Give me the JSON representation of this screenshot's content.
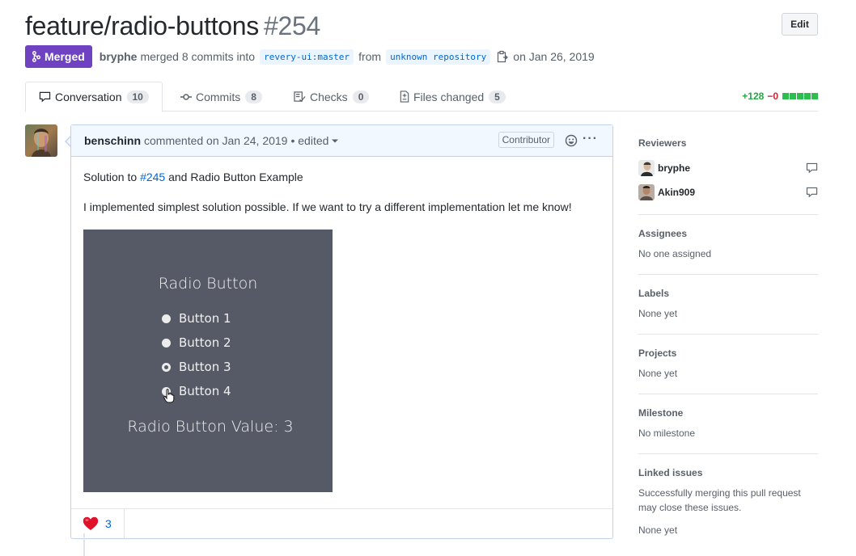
{
  "pr": {
    "title": "feature/radio-buttons",
    "number": "#254",
    "edit_label": "Edit",
    "state_label": "Merged",
    "author": "bryphe",
    "merge_text": "merged 8 commits into",
    "base_branch": "revery-ui:master",
    "from_text": "from",
    "head_branch": "unknown repository",
    "date_text": "on Jan 26, 2019"
  },
  "tabs": [
    {
      "label": "Conversation",
      "count": "10",
      "icon": "comment-icon"
    },
    {
      "label": "Commits",
      "count": "8",
      "icon": "commit-icon"
    },
    {
      "label": "Checks",
      "count": "0",
      "icon": "checklist-icon"
    },
    {
      "label": "Files changed",
      "count": "5",
      "icon": "file-diff-icon"
    }
  ],
  "diffstat": {
    "additions": "+128",
    "deletions": "−0"
  },
  "comment": {
    "author": "benschinn",
    "action": "commented on Jan 24, 2019",
    "edited": "• edited",
    "role_label": "Contributor",
    "line1_prefix": "Solution to ",
    "line1_link": "#245",
    "line1_suffix": " and Radio Button Example",
    "line2": "I implemented simplest solution possible. If we want to try a different implementation let me know!",
    "image": {
      "title": "Radio Button",
      "options": [
        "Button 1",
        "Button 2",
        "Button 3",
        "Button 4"
      ],
      "selected_index": 2,
      "value_text": "Radio Button Value: 3"
    },
    "reactions": [
      {
        "emoji": "heart-icon",
        "count": "3"
      }
    ]
  },
  "sidebar": {
    "reviewers_heading": "Reviewers",
    "reviewers": [
      {
        "name": "bryphe"
      },
      {
        "name": "Akin909"
      }
    ],
    "assignees_heading": "Assignees",
    "assignees_text": "No one assigned",
    "labels_heading": "Labels",
    "labels_text": "None yet",
    "projects_heading": "Projects",
    "projects_text": "None yet",
    "milestone_heading": "Milestone",
    "milestone_text": "No milestone",
    "linked_heading": "Linked issues",
    "linked_text": "Successfully merging this pull request may close these issues.",
    "linked_value": "None yet"
  },
  "colors": {
    "merged": "#6f42c1",
    "link": "#0366d6",
    "additions": "#28a745",
    "deletions": "#cb2431",
    "comment_border": "#c0d3eb",
    "comment_header_bg": "#f1f8ff",
    "demo_bg": "#565a66"
  }
}
